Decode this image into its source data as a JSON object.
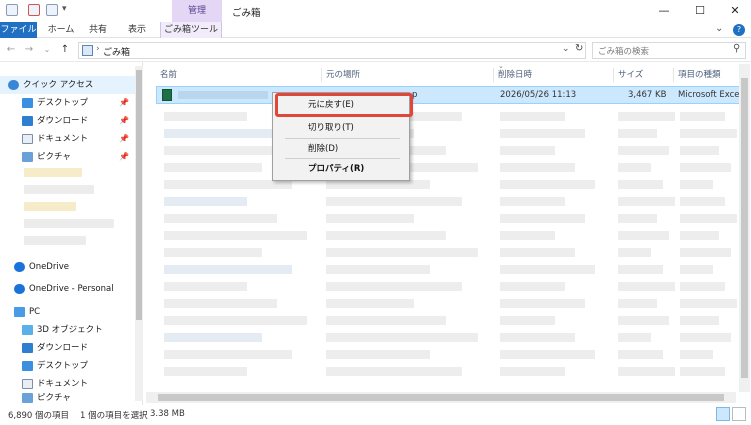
{
  "window": {
    "title": "ごみ箱",
    "context_tab_group": "管理",
    "minimize_glyph": "—",
    "maximize_glyph": "☐",
    "close_glyph": "✕"
  },
  "ribbon": {
    "tabs": [
      "ファイル",
      "ホーム",
      "共有",
      "表示",
      "ごみ箱ツール"
    ],
    "expand_glyph": "⌄",
    "help_glyph": "?"
  },
  "address": {
    "back_glyph": "←",
    "forward_glyph": "→",
    "recent_glyph": "⌄",
    "up_glyph": "↑",
    "separator": "›",
    "path": "ごみ箱",
    "dropdown_glyph": "⌄",
    "refresh_glyph": "↻",
    "search_placeholder": "ごみ箱の検索",
    "search_glyph": "⚲"
  },
  "sidebar": {
    "quick_access": "クイック アクセス",
    "quick_items": [
      "デスクトップ",
      "ダウンロード",
      "ドキュメント",
      "ピクチャ"
    ],
    "pin_glyph": "📌",
    "onedrive": "OneDrive",
    "onedrive_personal": "OneDrive - Personal",
    "pc": "PC",
    "pc_items": [
      "3D オブジェクト",
      "ダウンロード",
      "デスクトップ",
      "ドキュメント",
      "ピクチャ"
    ]
  },
  "columns": [
    "名前",
    "元の場所",
    "削除日時",
    "サイズ",
    "項目の種類"
  ],
  "sort_glyph": "⌄",
  "selected_row": {
    "original_location_tail": "p",
    "deleted_at": "2026/05/26 11:13",
    "size": "3,467 KB",
    "type": "Microsoft Excel"
  },
  "context_menu": {
    "restore": "元に戻す(E)",
    "cut": "切り取り(T)",
    "delete": "削除(D)",
    "properties": "プロパティ(R)"
  },
  "status": {
    "item_count": "6,890 個の項目",
    "selection": "1 個の項目を選択",
    "selection_size": "3.38 MB"
  },
  "colors": {
    "accent": "#1f6fc2",
    "selection": "#cce8ff",
    "highlight_box": "#e0463a",
    "manage_tab": "#e3d7f5"
  }
}
